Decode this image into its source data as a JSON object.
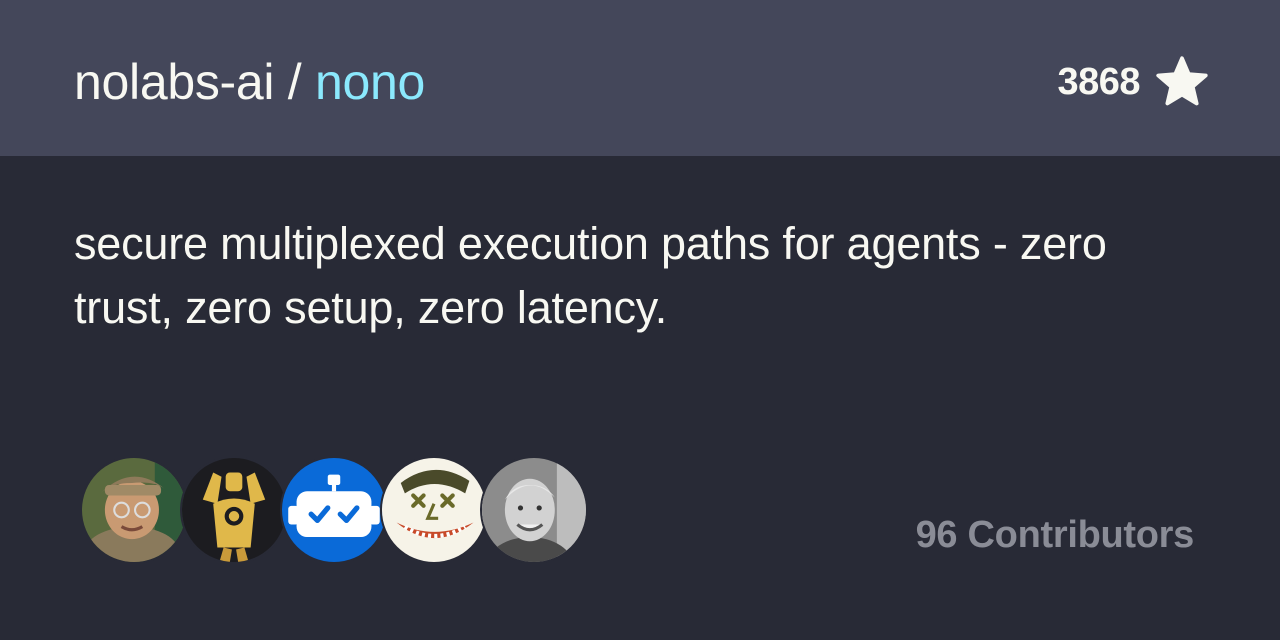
{
  "repo": {
    "owner": "nolabs-ai",
    "separator": " / ",
    "name": "nono",
    "description": "secure multiplexed execution paths for agents - zero trust, zero setup, zero latency.",
    "stars": "3868",
    "star_icon": "star-icon"
  },
  "contributors": {
    "label": "96 Contributors",
    "avatars": [
      {
        "icon": "avatar-photo-person-hat"
      },
      {
        "icon": "avatar-illustration-knight"
      },
      {
        "icon": "avatar-bot"
      },
      {
        "icon": "avatar-cartoon-face"
      },
      {
        "icon": "avatar-photo-person"
      }
    ]
  },
  "colors": {
    "background": "#282a36",
    "header": "#44475a",
    "accent": "#8be9fd",
    "text": "#f8f8f2",
    "muted": "#8a8c96"
  }
}
